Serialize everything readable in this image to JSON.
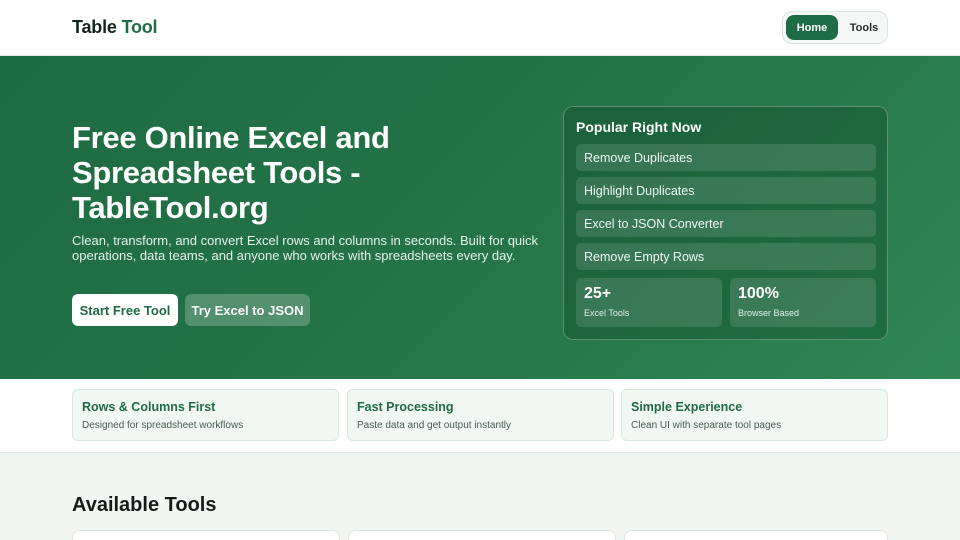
{
  "header": {
    "brand_part1": "Table",
    "brand_part2": "Tool",
    "nav": {
      "home": "Home",
      "tools": "Tools"
    }
  },
  "hero": {
    "title": "Free Online Excel and Spreadsheet Tools - TableTool.org",
    "subtitle": "Clean, transform, and convert Excel rows and columns in seconds. Built for quick operations, data teams, and anyone who works with spreadsheets every day.",
    "primary_button": "Start Free Tool",
    "secondary_button": "Try Excel to JSON"
  },
  "popular": {
    "title": "Popular Right Now",
    "items": [
      {
        "label": "Remove Duplicates"
      },
      {
        "label": "Highlight Duplicates"
      },
      {
        "label": "Excel to JSON Converter"
      },
      {
        "label": "Remove Empty Rows"
      }
    ],
    "stats": [
      {
        "value": "25+",
        "label": "Excel Tools"
      },
      {
        "value": "100%",
        "label": "Browser Based"
      }
    ]
  },
  "features": [
    {
      "title": "Rows & Columns First",
      "description": "Designed for spreadsheet workflows"
    },
    {
      "title": "Fast Processing",
      "description": "Paste data and get output instantly"
    },
    {
      "title": "Simple Experience",
      "description": "Clean UI with separate tool pages"
    }
  ],
  "tools_section": {
    "heading": "Available Tools"
  },
  "colors": {
    "brand": "#1f6b45",
    "hero_start": "#1e6a42",
    "hero_end": "#2d8754",
    "feature_bg": "#f1f8f4"
  }
}
